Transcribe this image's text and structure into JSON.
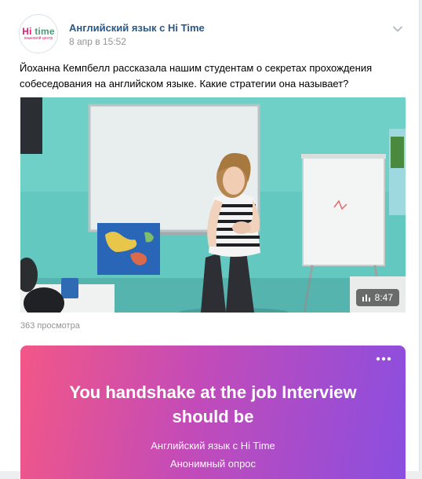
{
  "post": {
    "avatar_logo_hi": "Hi",
    "avatar_logo_word": " time",
    "avatar_logo_sub": "языковой центр",
    "author": "Английский язык с Hi Time",
    "date": "8 апр в 15:52",
    "text": "Йоханна Кемпбелл рассказала нашим студентам о секретах прохождения собеседования на английском языке. Какие стратегии она называет?",
    "video_duration": "8:47",
    "views": "363 просмотра"
  },
  "poll": {
    "question": "You handshake at the job Interview should be",
    "author": "Английский язык с Hi Time",
    "type": "Анонимный опрос"
  },
  "colors": {
    "link": "#2a5885",
    "meta": "#939393",
    "poll_gradient_start": "#f25787",
    "poll_gradient_end": "#8a4ee0"
  }
}
